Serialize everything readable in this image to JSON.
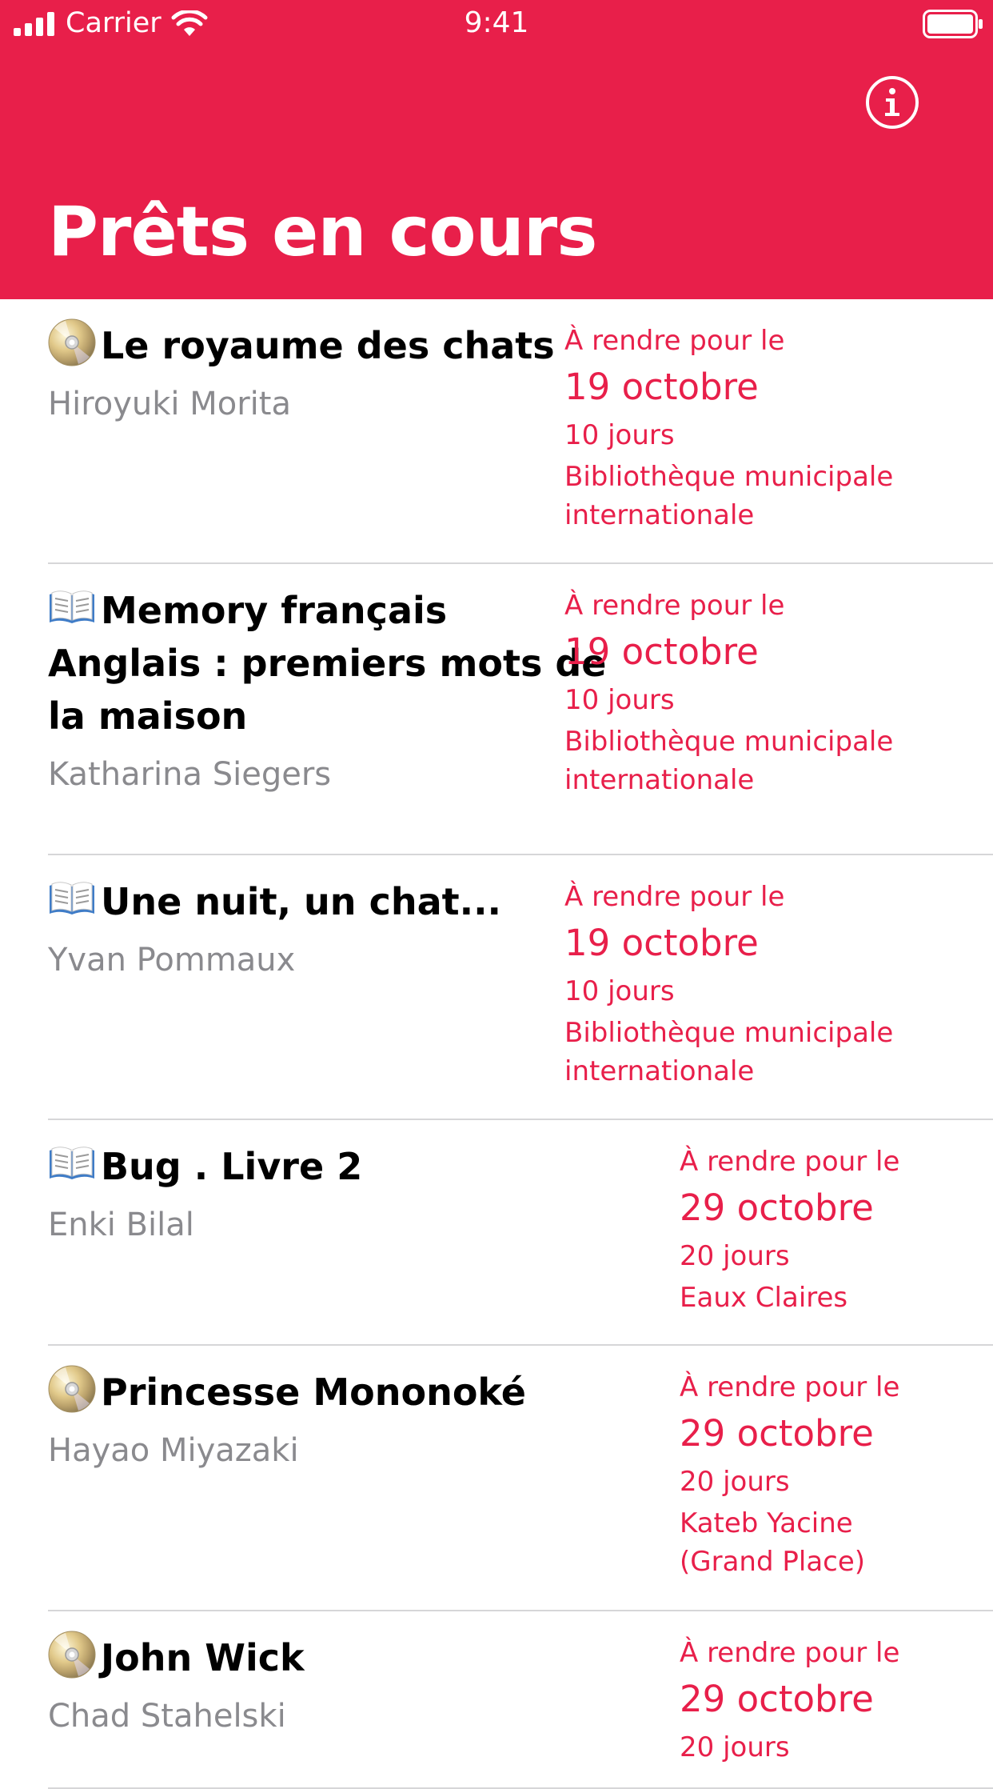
{
  "status_bar": {
    "carrier": "Carrier",
    "time": "9:41"
  },
  "header": {
    "title": "Prêts en cours",
    "info_icon": "info-circle-icon",
    "background_color": "#e81f4a"
  },
  "loans": [
    {
      "type": "dvd",
      "title_lines": [
        "Le royaume des chats"
      ],
      "author": "Hiroyuki Morita",
      "due_label": "À rendre pour le",
      "due_date": "19 octobre",
      "remaining": "10 jours",
      "branch_lines": [
        "Bibliothèque municipale",
        "internationale"
      ]
    },
    {
      "type": "book",
      "title_lines": [
        "Memory français",
        "Anglais : premiers mots de",
        "la maison"
      ],
      "author": "Katharina Siegers",
      "due_label": "À rendre pour le",
      "due_date": "19 octobre",
      "remaining": "10 jours",
      "branch_lines": [
        "Bibliothèque municipale",
        "internationale"
      ]
    },
    {
      "type": "book",
      "title_lines": [
        "Une nuit, un chat..."
      ],
      "author": "Yvan Pommaux",
      "due_label": "À rendre pour le",
      "due_date": "19 octobre",
      "remaining": "10 jours",
      "branch_lines": [
        "Bibliothèque municipale",
        "internationale"
      ]
    },
    {
      "type": "book",
      "title_lines": [
        "Bug . Livre 2"
      ],
      "author": "Enki Bilal",
      "due_label": "À rendre pour le",
      "due_date": "29 octobre",
      "remaining": "20 jours",
      "branch_lines": [
        "Eaux Claires"
      ]
    },
    {
      "type": "dvd",
      "title_lines": [
        "Princesse Mononoké"
      ],
      "author": "Hayao Miyazaki",
      "due_label": "À rendre pour le",
      "due_date": "29 octobre",
      "remaining": "20 jours",
      "branch_lines": [
        "Kateb Yacine",
        "(Grand Place)"
      ]
    },
    {
      "type": "dvd",
      "title_lines": [
        "John Wick"
      ],
      "author": "Chad Stahelski",
      "due_label": "À rendre pour le",
      "due_date": "29 octobre",
      "remaining": "20 jours",
      "branch_lines": []
    }
  ]
}
